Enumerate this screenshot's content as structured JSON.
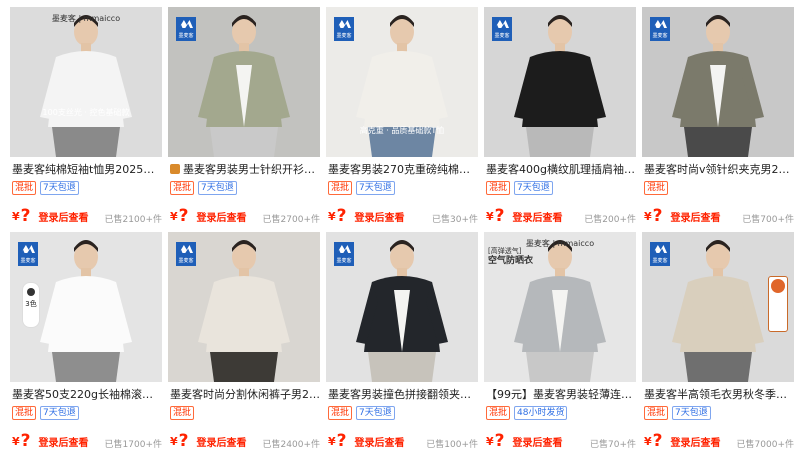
{
  "products": [
    {
      "title": "墨麦客纯棉短袖t恤男2025夏长...",
      "tags": [
        {
          "text": "混批",
          "color": "red"
        },
        {
          "text": "7天包退",
          "color": "blue"
        }
      ],
      "price_symbol": "¥",
      "price_hidden": "?",
      "login_text": "登录后查看",
      "sold": "已售2100+件",
      "prefix_icon": "",
      "image": {
        "shirt": "#f4f4f4",
        "pants": "#8a8a8a",
        "bg": "#dcdcdc",
        "brand": "墨麦客 | mmaicco",
        "caption": "100支丝光 · 控色基础款"
      }
    },
    {
      "title": "墨麦客男装男士针织开衫2...",
      "tags": [
        {
          "text": "混批",
          "color": "red"
        },
        {
          "text": "7天包退",
          "color": "blue"
        }
      ],
      "price_symbol": "¥",
      "price_hidden": "?",
      "login_text": "登录后查看",
      "sold": "已售2700+件",
      "prefix_icon": "store-icon",
      "image": {
        "shirt": "#a3a88e",
        "pants": "#c9c9c9",
        "bg": "#c2c2bf",
        "brand": "",
        "logo": "墨麦客"
      }
    },
    {
      "title": "墨麦客男装270克重磅纯棉长...",
      "tags": [
        {
          "text": "混批",
          "color": "red"
        },
        {
          "text": "7天包退",
          "color": "blue"
        }
      ],
      "price_symbol": "¥",
      "price_hidden": "?",
      "login_text": "登录后查看",
      "sold": "已售30+件",
      "prefix_icon": "",
      "image": {
        "shirt": "#f1efea",
        "pants": "#6d86a3",
        "bg": "#ecebe8",
        "brand": "",
        "logo": "墨麦客",
        "caption": "高克重 · 品质基础款T恤"
      }
    },
    {
      "title": "墨麦客400g横纹肌理插肩袖外...",
      "tags": [
        {
          "text": "混批",
          "color": "red"
        },
        {
          "text": "7天包退",
          "color": "blue"
        }
      ],
      "price_symbol": "¥",
      "price_hidden": "?",
      "login_text": "登录后查看",
      "sold": "已售200+件",
      "prefix_icon": "",
      "image": {
        "shirt": "#1c1c1c",
        "pants": "#b9b9b9",
        "bg": "#d6d6d6",
        "brand": "",
        "logo": "墨麦客"
      }
    },
    {
      "title": "墨麦客时尚v领针织夹克男2025...",
      "tags": [
        {
          "text": "混批",
          "color": "red"
        }
      ],
      "price_symbol": "¥",
      "price_hidden": "?",
      "login_text": "登录后查看",
      "sold": "已售700+件",
      "prefix_icon": "",
      "image": {
        "shirt": "#7b7a6b",
        "pants": "#4a4a4a",
        "bg": "#c8c8c8",
        "brand": "",
        "logo": "墨麦客"
      }
    },
    {
      "title": "墨麦客50支220g长袖棉滚氨长...",
      "tags": [
        {
          "text": "混批",
          "color": "red"
        },
        {
          "text": "7天包退",
          "color": "blue"
        }
      ],
      "price_symbol": "¥",
      "price_hidden": "?",
      "login_text": "登录后查看",
      "sold": "已售1700+件",
      "prefix_icon": "",
      "image": {
        "shirt": "#fbfbfb",
        "pants": "#8e8e8e",
        "bg": "#e4e4e4",
        "brand": "",
        "logo": "墨麦客",
        "side": "3色"
      }
    },
    {
      "title": "墨麦客时尚分割休闲裤子男202...",
      "tags": [
        {
          "text": "混批",
          "color": "red"
        }
      ],
      "price_symbol": "¥",
      "price_hidden": "?",
      "login_text": "登录后查看",
      "sold": "已售2400+件",
      "prefix_icon": "",
      "image": {
        "shirt": "#e9e4dc",
        "pants": "#3d3a36",
        "bg": "#d9d6d1",
        "brand": "",
        "logo": "墨麦客"
      }
    },
    {
      "title": "墨麦客男装撞色拼接翻领夹克...",
      "tags": [
        {
          "text": "混批",
          "color": "red"
        },
        {
          "text": "7天包退",
          "color": "blue"
        }
      ],
      "price_symbol": "¥",
      "price_hidden": "?",
      "login_text": "登录后查看",
      "sold": "已售100+件",
      "prefix_icon": "",
      "image": {
        "shirt": "#23262b",
        "pants": "#c7c3bb",
        "bg": "#e2e2e2",
        "brand": "",
        "logo": "墨麦客"
      }
    },
    {
      "title": "【99元】墨麦客男装轻薄连帽...",
      "tags": [
        {
          "text": "混批",
          "color": "red"
        },
        {
          "text": "48小时发货",
          "color": "blue"
        }
      ],
      "price_symbol": "¥",
      "price_hidden": "?",
      "login_text": "登录后查看",
      "sold": "已售70+件",
      "prefix_icon": "",
      "image": {
        "shirt": "#b5b8bb",
        "pants": "#c8c8c8",
        "bg": "#e6e6e6",
        "brand": "墨麦客 | mmaicco",
        "promo": "空气防晒衣",
        "promo_sub": "[高弹透气]"
      }
    },
    {
      "title": "墨麦客半高领毛衣男秋冬季百...",
      "tags": [
        {
          "text": "混批",
          "color": "red"
        },
        {
          "text": "7天包退",
          "color": "blue"
        }
      ],
      "price_symbol": "¥",
      "price_hidden": "?",
      "login_text": "登录后查看",
      "sold": "已售7000+件",
      "prefix_icon": "",
      "image": {
        "shirt": "#d9cfbd",
        "pants": "#6f6f6f",
        "bg": "#dadada",
        "brand": "",
        "logo": "墨麦客",
        "fire": true
      }
    }
  ]
}
